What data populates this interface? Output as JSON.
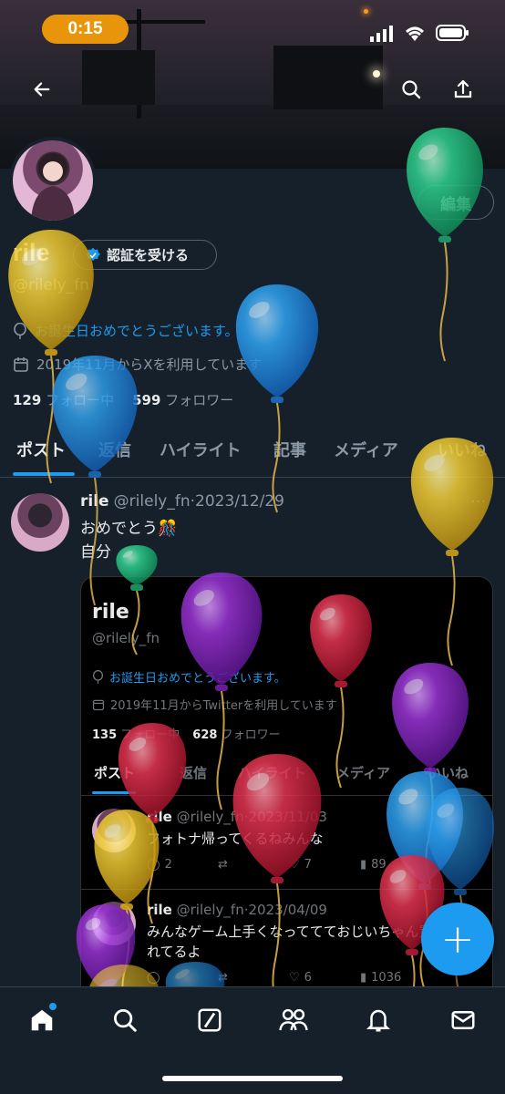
{
  "status_bar": {
    "time": "0:15"
  },
  "header": {
    "back_icon": "back-arrow-icon",
    "search_icon": "search-icon",
    "share_icon": "share-icon"
  },
  "profile": {
    "edit_label": "編集",
    "name": "rile",
    "verify_label": "認証を受ける",
    "handle": "@rilely_fn",
    "birthday_text": "お誕生日おめでとうございます。",
    "joined_text": "2019年11月からXを利用しています",
    "following_count": "129",
    "following_label": "フォロー中",
    "followers_count": "599",
    "followers_label": "フォロワー"
  },
  "tabs": [
    "ポスト",
    "返信",
    "ハイライト",
    "記事",
    "メディア",
    "いいね"
  ],
  "post": {
    "name": "rile",
    "handle": "@rilely_fn",
    "date": "2023/12/29",
    "line1": "おめでとう🎊",
    "line2": "自分",
    "more_icon": "more-icon"
  },
  "embed": {
    "name": "rile",
    "handle": "@rilely_fn",
    "birthday_text": "お誕生日おめでとうございます。",
    "joined_text": "2019年11月からTwitterを利用しています",
    "following_count": "135",
    "following_label": "フォロー中",
    "followers_count": "628",
    "followers_label": "フォロワー",
    "tabs": [
      "ポスト",
      "返信",
      "ハイライト",
      "メディア",
      "いいね"
    ],
    "posts": [
      {
        "name": "rile",
        "handle": "@rilely_fn",
        "date": "2023/11/03",
        "text": "フォトナ帰ってくるねみんな",
        "replies": "2",
        "likes": "7",
        "views": "89"
      },
      {
        "name": "rile",
        "handle": "@rilely_fn",
        "date": "2023/04/09",
        "text": "みんなゲーム上手くなっててておじいちゃん置いてかれてるよ",
        "likes": "6",
        "views": "1036"
      }
    ]
  },
  "fab": {
    "label": "+"
  },
  "bottom_nav": [
    "home-icon",
    "search-icon",
    "grok-icon",
    "communities-icon",
    "notifications-icon",
    "messages-icon"
  ],
  "colors": {
    "accent": "#1d9bf0",
    "background": "#15202b",
    "balloon_colors": [
      "#e8c12a",
      "#2aa1f0",
      "#2bd18a",
      "#e0344f",
      "#9b33d6"
    ]
  }
}
